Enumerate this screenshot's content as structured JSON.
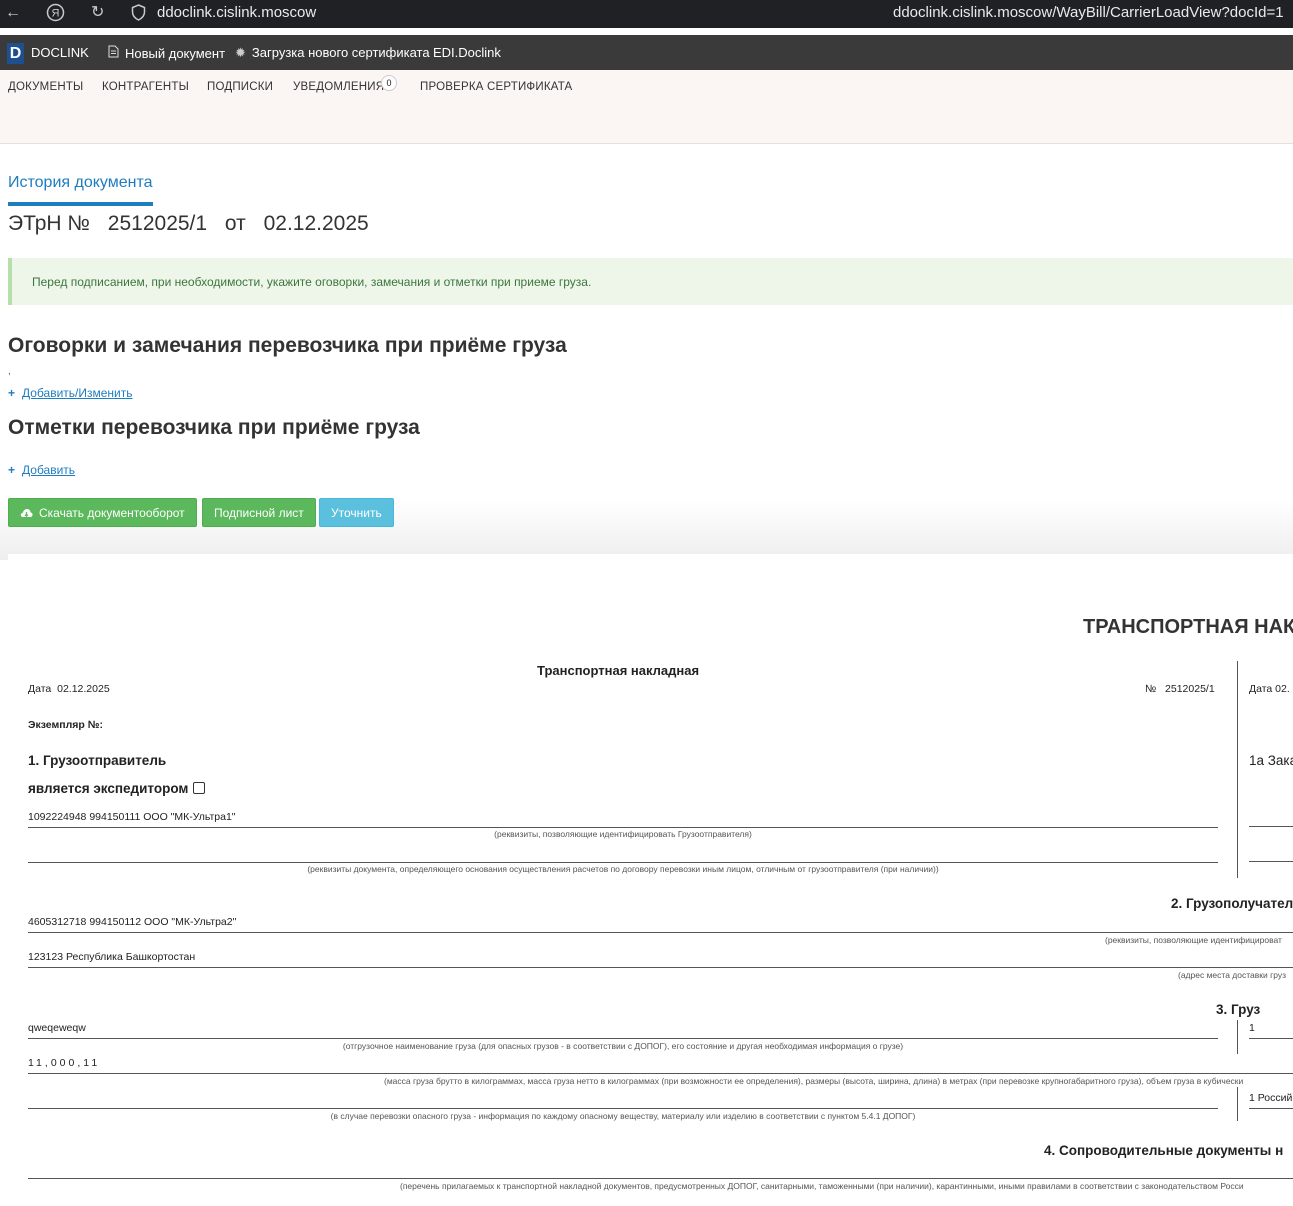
{
  "browser": {
    "host": "ddoclink.cislink.moscow",
    "full_url": "ddoclink.cislink.moscow/WayBill/CarrierLoadView?docId=1",
    "back_icon": "arrow-left-icon",
    "yandex_icon": "yandex-icon",
    "reload_icon": "reload-icon",
    "shield_icon": "shield-icon"
  },
  "header": {
    "logo_letter": "D",
    "brand": "DOCLINK",
    "new_doc": "Новый документ",
    "upload_cert": "Загрузка нового сертификата",
    "edi": "EDI.Doclink"
  },
  "nav": {
    "documents": "ДОКУМЕНТЫ",
    "contractors": "КОНТРАГЕНТЫ",
    "subscriptions": "ПОДПИСКИ",
    "notifications": "УВЕДОМЛЕНИЯ",
    "notifications_count": "0",
    "check_cert": "ПРОВЕРКА СЕРТИФИКАТА"
  },
  "page": {
    "history_tab": "История документа",
    "title_prefix": "ЭТрН №",
    "doc_number": "2512025/1",
    "title_from": "от",
    "doc_date": "02.12.2025",
    "alert": "Перед подписанием, при необходимости, укажите оговорки, замечания и отметки при приеме груза.",
    "section1": "Оговорки и замечания перевозчика при приёме груза",
    "section1_note": ",",
    "add_change": "Добавить/Изменить",
    "section2": "Отметки перевозчика при приёме груза",
    "add": "Добавить",
    "btn_download": "Скачать документооборот",
    "btn_sign_sheet": "Подписной лист",
    "btn_clarify": "Уточнить"
  },
  "paper": {
    "main_title": "ТРАНСПОРТНАЯ НАК",
    "subtitle": "Транспортная накладная",
    "date_label": "Дата",
    "date_value": "02.12.2025",
    "number_label": "№",
    "number_value": "2512025/1",
    "right_date": "Дата 02.",
    "copy_label": "Экземпляр №:",
    "s1_title": "1. Грузоотправитель",
    "s1_forwarder": "является экспедитором",
    "s1a_title": "1а Зака",
    "shipper_value": "1092224948 994150111 ООО \"МК-Ультра1\"",
    "cap_shipper": "(реквизиты, позволяющие идентифицировать Грузоотправителя)",
    "cap_payment_doc": "(реквизиты документа, определяющего основания осуществления расчетов по договору перевозки иным лицом, отличным от грузоотправителя (при наличии))",
    "s2_title": "2. Грузополучател",
    "consignee_value": "4605312718 994150112 ООО \"МК-Ультра2\"",
    "cap_consignee": "(реквизиты, позволяющие идентифицироват",
    "address_value": "123123 Республика Башкортостан",
    "cap_address": "(адрес места доставки груз",
    "s3_title": "3. Груз",
    "cargo_name": "qweqeweqw",
    "cargo_right_value": "1",
    "cap_cargo": "(отгрузочное наименование груза (для опасных грузов - в соответствии с ДОПОГ), его состояние и другая необходимая информация о грузе)",
    "mass_value": "11,000,11",
    "cap_mass": "(масса груза брутто в килограммах, масса груза нетто в килограммах (при возможности ее определения), размеры (высота, ширина, длина) в метрах (при перевозке крупногабаритного груза), объем груза в кубически",
    "right_country": "1 Россий",
    "cap_dangerous": "(в случае перевозки опасного груза - информация по каждому опасному веществу, материалу или изделию в соответствии с пунктом 5.4.1 ДОПОГ)",
    "s4_title": "4. Сопроводительные документы н",
    "cap_docs": "(перечень прилагаемых к транспортной накладной документов, предусмотренных ДОПОГ, санитарными, таможенными (при наличии), карантинными, иными правилами в соответствии с законодательством Росси"
  }
}
